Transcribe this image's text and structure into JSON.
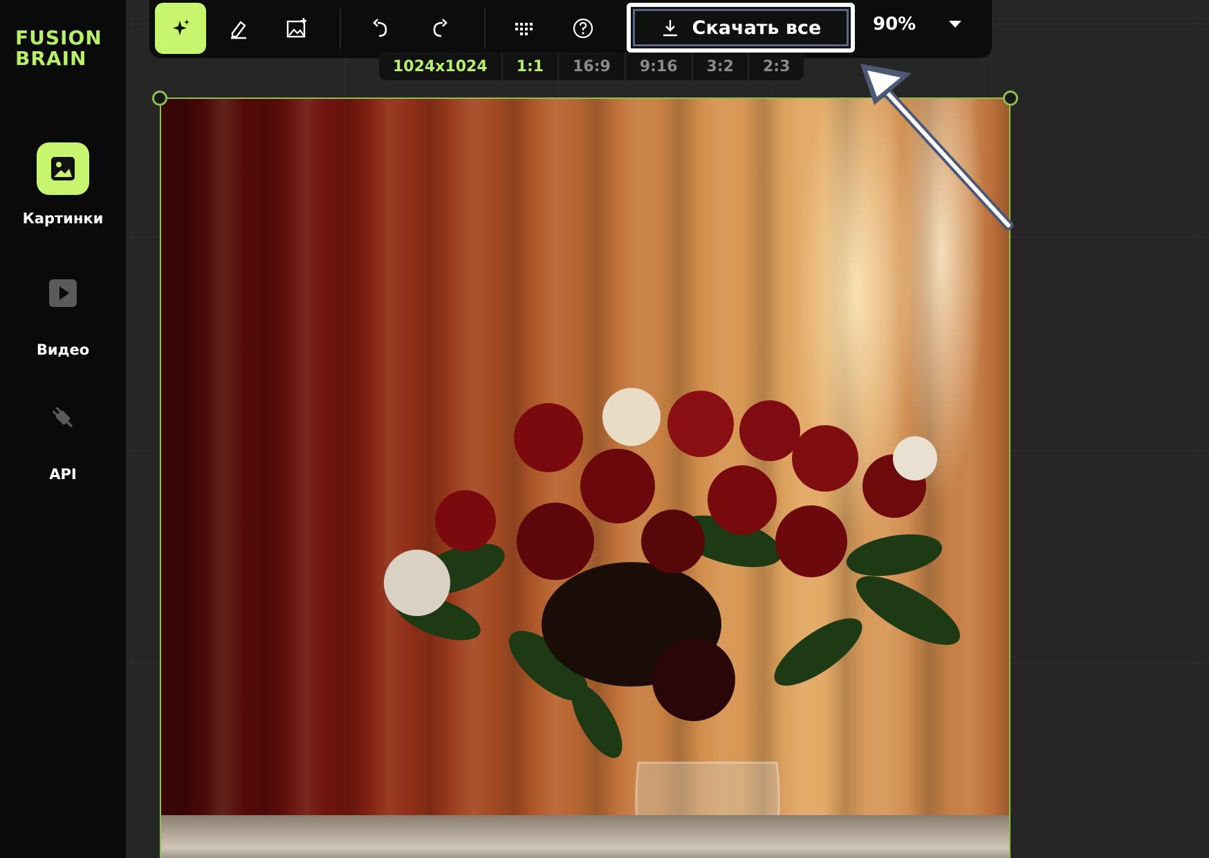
{
  "app": {
    "logo_line1": "FUSION",
    "logo_line2": "BRAIN",
    "brand_color": "#c8f56e"
  },
  "sidebar": {
    "items": [
      {
        "label": "Картинки",
        "icon": "image-icon",
        "active": true
      },
      {
        "label": "Видео",
        "icon": "play-icon",
        "active": false
      },
      {
        "label": "API",
        "icon": "plug-icon",
        "active": false
      }
    ]
  },
  "toolbar": {
    "tools": [
      {
        "icon": "sparkle-icon",
        "active": true
      },
      {
        "icon": "eraser-icon",
        "active": false
      },
      {
        "icon": "image-add-icon",
        "active": false
      },
      {
        "icon": "undo-icon",
        "active": false
      },
      {
        "icon": "redo-icon",
        "active": false
      },
      {
        "icon": "grid-dots-icon",
        "active": false
      },
      {
        "icon": "help-icon",
        "active": false
      }
    ],
    "download_label": "Скачать все",
    "download_icon": "download-icon",
    "zoom": "90%"
  },
  "sizes": {
    "resolution": "1024x1024",
    "ratios": [
      "1:1",
      "16:9",
      "9:16",
      "3:2",
      "2:3"
    ],
    "selected_ratio": "1:1"
  },
  "canvas": {
    "image_subject": "bouquet of red and white roses in glass vase"
  }
}
